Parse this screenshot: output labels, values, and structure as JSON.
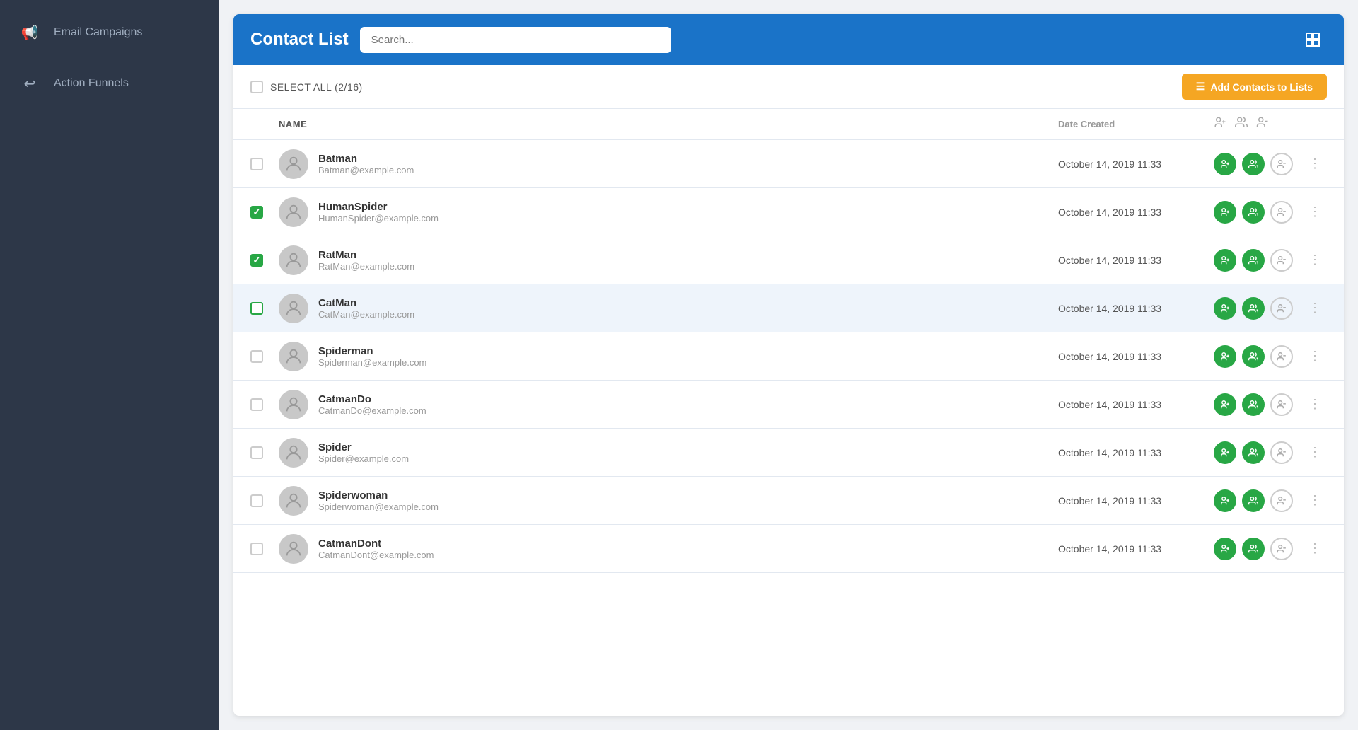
{
  "sidebar": {
    "items": [
      {
        "id": "email-campaigns",
        "label": "Email Campaigns",
        "icon": "📢"
      },
      {
        "id": "action-funnels",
        "label": "Action Funnels",
        "icon": "↩"
      }
    ]
  },
  "header": {
    "title": "Contact List",
    "search_placeholder": "Search...",
    "layout_icon": "⊞"
  },
  "toolbar": {
    "select_all_label": "SELECT ALL (2/16)",
    "add_contacts_label": "Add Contacts to Lists",
    "add_contacts_icon": "☰"
  },
  "table": {
    "columns": {
      "name": "NAME",
      "date": "Date Created"
    },
    "rows": [
      {
        "id": 1,
        "name": "Batman",
        "email": "Batman@example.com",
        "date": "October 14, 2019 11:33",
        "checked": false,
        "highlighted": false
      },
      {
        "id": 2,
        "name": "HumanSpider",
        "email": "HumanSpider@example.com",
        "date": "October 14, 2019 11:33",
        "checked": true,
        "highlighted": false
      },
      {
        "id": 3,
        "name": "RatMan",
        "email": "RatMan@example.com",
        "date": "October 14, 2019 11:33",
        "checked": true,
        "highlighted": false
      },
      {
        "id": 4,
        "name": "CatMan",
        "email": "CatMan@example.com",
        "date": "October 14, 2019 11:33",
        "checked": false,
        "highlighted": true
      },
      {
        "id": 5,
        "name": "Spiderman",
        "email": "Spiderman@example.com",
        "date": "October 14, 2019 11:33",
        "checked": false,
        "highlighted": false
      },
      {
        "id": 6,
        "name": "CatmanDo",
        "email": "CatmanDo@example.com",
        "date": "October 14, 2019 11:33",
        "checked": false,
        "highlighted": false
      },
      {
        "id": 7,
        "name": "Spider",
        "email": "Spider@example.com",
        "date": "October 14, 2019 11:33",
        "checked": false,
        "highlighted": false
      },
      {
        "id": 8,
        "name": "Spiderwoman",
        "email": "Spiderwoman@example.com",
        "date": "October 14, 2019 11:33",
        "checked": false,
        "highlighted": false
      },
      {
        "id": 9,
        "name": "CatmanDont",
        "email": "CatmanDont@example.com",
        "date": "October 14, 2019 11:33",
        "checked": false,
        "highlighted": false
      }
    ]
  },
  "colors": {
    "sidebar_bg": "#2d3748",
    "header_bg": "#1a73c8",
    "green": "#28a745",
    "amber": "#f5a623"
  }
}
